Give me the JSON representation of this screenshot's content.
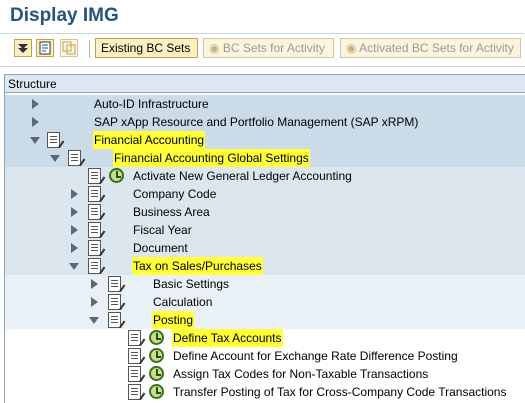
{
  "window": {
    "title": "Display IMG"
  },
  "toolbar": {
    "existing_bc_sets": "Existing BC Sets",
    "bc_sets_for_activity": "BC Sets for Activity",
    "activated_bc_sets_for_activity": "Activated BC Sets for Activity"
  },
  "tree": {
    "header": "Structure",
    "rows": [
      {
        "label": "Auto-ID Infrastructure"
      },
      {
        "label": "SAP xApp Resource and Portfolio Management (SAP xRPM)"
      },
      {
        "label": "Financial Accounting"
      },
      {
        "label": "Financial Accounting Global Settings"
      },
      {
        "label": "Activate New General Ledger Accounting"
      },
      {
        "label": "Company Code"
      },
      {
        "label": "Business Area"
      },
      {
        "label": "Fiscal Year"
      },
      {
        "label": "Document"
      },
      {
        "label": "Tax on Sales/Purchases"
      },
      {
        "label": "Basic Settings"
      },
      {
        "label": "Calculation"
      },
      {
        "label": "Posting"
      },
      {
        "label": "Define Tax Accounts"
      },
      {
        "label": "Define Account for Exchange Rate Difference Posting"
      },
      {
        "label": "Assign Tax Codes for Non-Taxable Transactions"
      },
      {
        "label": "Transfer Posting of Tax for Cross-Company Code Transactions"
      }
    ]
  },
  "colors": {
    "highlight": "#ffff3a",
    "title": "#26547c",
    "band": "#cbdbe8"
  }
}
